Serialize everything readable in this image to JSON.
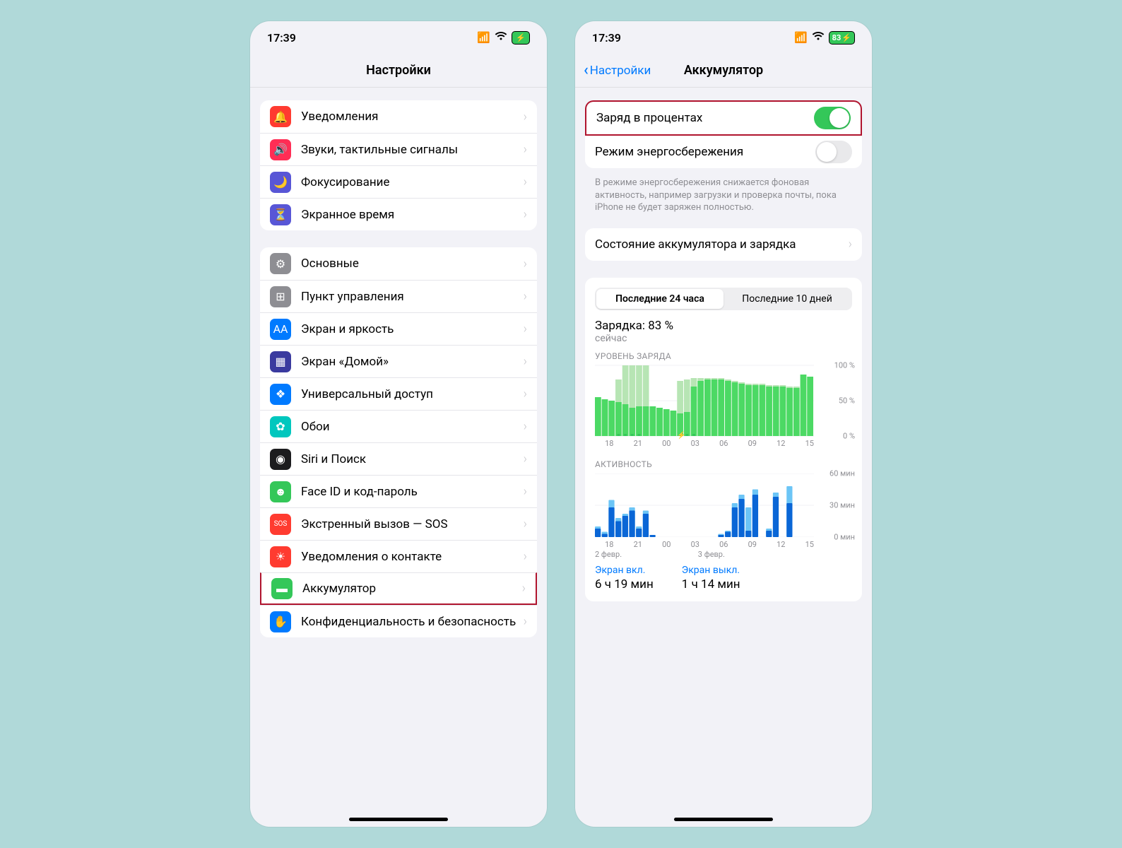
{
  "status": {
    "time": "17:39",
    "battery_text": "83"
  },
  "phone1": {
    "title": "Настройки",
    "group1": [
      {
        "icon": "🔔",
        "bg": "#ff3b30",
        "label": "Уведомления"
      },
      {
        "icon": "🔊",
        "bg": "#ff2d55",
        "label": "Звуки, тактильные сигналы"
      },
      {
        "icon": "🌙",
        "bg": "#5856d6",
        "label": "Фокусирование"
      },
      {
        "icon": "⏳",
        "bg": "#5856d6",
        "label": "Экранное время"
      }
    ],
    "group2": [
      {
        "icon": "⚙︎",
        "bg": "#8e8e93",
        "label": "Основные"
      },
      {
        "icon": "⊞",
        "bg": "#8e8e93",
        "label": "Пункт управления"
      },
      {
        "icon": "AA",
        "bg": "#007aff",
        "label": "Экран и яркость"
      },
      {
        "icon": "▦",
        "bg": "#3a3a9f",
        "label": "Экран «Домой»"
      },
      {
        "icon": "❖",
        "bg": "#007aff",
        "label": "Универсальный доступ"
      },
      {
        "icon": "✿",
        "bg": "#00c7be",
        "label": "Обои"
      },
      {
        "icon": "◉",
        "bg": "#1c1c1e",
        "label": "Siri и Поиск"
      },
      {
        "icon": "☻",
        "bg": "#34c759",
        "label": "Face ID и код-пароль"
      },
      {
        "icon": "SOS",
        "bg": "#ff3b30",
        "label": "Экстренный вызов — SOS",
        "small": true
      },
      {
        "icon": "☀",
        "bg": "#ff3b30",
        "label": "Уведомления о контакте"
      },
      {
        "icon": "▬",
        "bg": "#34c759",
        "label": "Аккумулятор",
        "hl": true
      },
      {
        "icon": "✋",
        "bg": "#007aff",
        "label": "Конфиденциальность и безопасность"
      }
    ]
  },
  "phone2": {
    "back": "Настройки",
    "title": "Аккумулятор",
    "rows": {
      "percent_label": "Заряд в процентах",
      "lowpower_label": "Режим энергосбережения",
      "footnote": "В режиме энергосбережения снижается фоновая активность, например загрузки и проверка почты, пока iPhone не будет заряжен полностью.",
      "health_label": "Состояние аккумулятора и зарядка"
    },
    "segmented": {
      "a": "Последние 24 часа",
      "b": "Последние 10 дней"
    },
    "charge_line": "Зарядка: 83 %",
    "charge_sub": "сейчас",
    "level_title": "УРОВЕНЬ ЗАРЯДА",
    "activity_title": "АКТИВНОСТЬ",
    "summary": {
      "on_title": "Экран вкл.",
      "on_val": "6 ч 19 мин",
      "off_title": "Экран выкл.",
      "off_val": "1 ч 14 мин"
    },
    "date_a": "2 февр.",
    "date_b": "3 февр."
  },
  "chart_data": [
    {
      "type": "bar",
      "title": "УРОВЕНЬ ЗАРЯДА",
      "ylabel": "%",
      "ylim": [
        0,
        100
      ],
      "y_ticks": [
        "100 %",
        "50 %",
        "0 %"
      ],
      "x_ticks": [
        "18",
        "21",
        "00",
        "03",
        "06",
        "09",
        "12",
        "15"
      ],
      "series": [
        {
          "name": "charge-light",
          "values": [
            55,
            52,
            50,
            80,
            100,
            100,
            100,
            100,
            42,
            40,
            38,
            36,
            78,
            80,
            82,
            82,
            82,
            82,
            82,
            80,
            78,
            76,
            74,
            74,
            74,
            72,
            72,
            72,
            70,
            70,
            87,
            84
          ]
        },
        {
          "name": "charge-solid",
          "values": [
            55,
            52,
            50,
            48,
            45,
            40,
            42,
            42,
            42,
            40,
            38,
            36,
            32,
            34,
            70,
            78,
            80,
            80,
            80,
            78,
            76,
            74,
            72,
            72,
            72,
            70,
            70,
            70,
            68,
            68,
            87,
            84
          ]
        }
      ],
      "charging_hours": [
        3,
        4,
        5,
        6,
        12,
        13,
        14
      ]
    },
    {
      "type": "bar",
      "title": "АКТИВНОСТЬ",
      "ylabel": "мин",
      "ylim": [
        0,
        60
      ],
      "y_ticks": [
        "60 мин",
        "30 мин",
        "0 мин"
      ],
      "x_ticks": [
        "18",
        "21",
        "00",
        "03",
        "06",
        "09",
        "12",
        "15"
      ],
      "series": [
        {
          "name": "screen-off",
          "color": "#6cc5f6",
          "values": [
            10,
            5,
            35,
            18,
            22,
            28,
            10,
            25,
            2,
            0,
            0,
            0,
            0,
            0,
            0,
            0,
            0,
            0,
            3,
            6,
            32,
            40,
            28,
            45,
            0,
            8,
            42,
            0,
            48,
            0,
            0,
            0
          ]
        },
        {
          "name": "screen-on",
          "color": "#0a66d6",
          "values": [
            8,
            3,
            28,
            15,
            20,
            25,
            8,
            22,
            2,
            0,
            0,
            0,
            0,
            0,
            0,
            0,
            0,
            0,
            2,
            5,
            28,
            36,
            6,
            40,
            0,
            6,
            38,
            0,
            32,
            0,
            0,
            0
          ]
        }
      ]
    }
  ]
}
